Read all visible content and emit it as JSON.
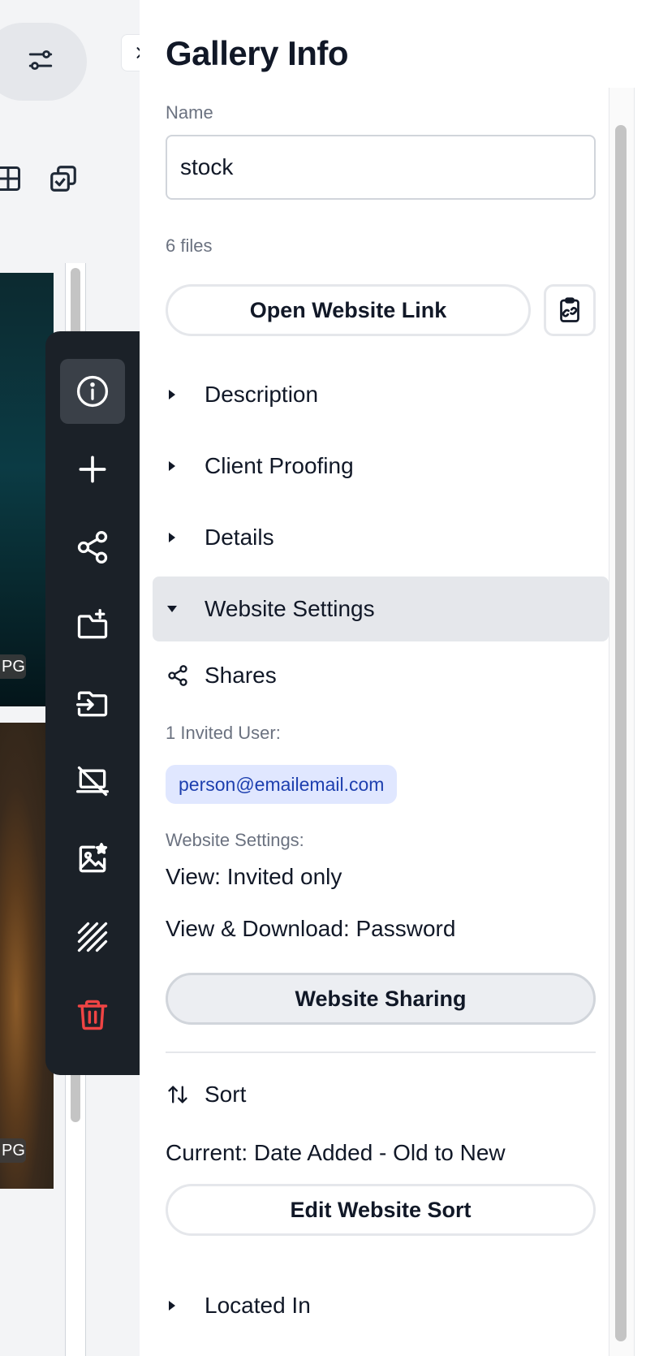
{
  "background": {
    "thumbnails": [
      {
        "ext_label": "PG"
      },
      {
        "ext_label": "PG"
      }
    ],
    "toolbar_icons": [
      "filter-sliders-icon",
      "grid-layout-icon",
      "select-multiple-icon"
    ]
  },
  "rail": {
    "items": [
      {
        "name": "info-icon",
        "active": true
      },
      {
        "name": "plus-icon"
      },
      {
        "name": "share-icon"
      },
      {
        "name": "folder-add-icon"
      },
      {
        "name": "move-to-folder-icon"
      },
      {
        "name": "hide-from-website-icon"
      },
      {
        "name": "image-featured-icon"
      },
      {
        "name": "hatch-pattern-icon"
      },
      {
        "name": "trash-icon",
        "color": "#ef4444"
      }
    ]
  },
  "panel": {
    "title": "Gallery Info",
    "name_label": "Name",
    "name_value": "stock",
    "file_count": "6 files",
    "open_link_label": "Open Website Link",
    "sections": {
      "description": "Description",
      "client_proofing": "Client Proofing",
      "details": "Details",
      "website_settings": "Website Settings",
      "located_in": "Located In"
    },
    "website": {
      "shares_label": "Shares",
      "invited_label": "1 Invited User:",
      "invited_email": "person@emailemail.com",
      "settings_label": "Website Settings:",
      "view_setting": "View: Invited only",
      "download_setting": "View & Download: Password",
      "sharing_button": "Website Sharing"
    },
    "sort": {
      "label": "Sort",
      "current": "Current: Date Added - Old to New",
      "edit_button": "Edit Website Sort"
    }
  },
  "colors": {
    "rail_bg": "#1b2128",
    "rail_active": "#3a4048",
    "delete": "#ef4444",
    "chip_bg": "#e0e7ff",
    "chip_text": "#1e40af",
    "open_section_bg": "#e5e7eb"
  }
}
